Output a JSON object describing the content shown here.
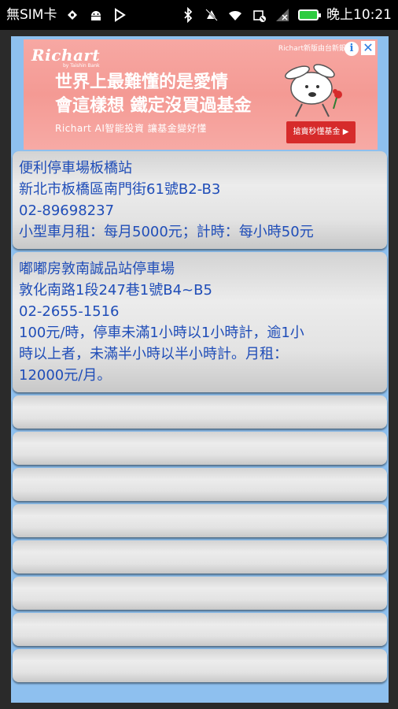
{
  "status_bar": {
    "carrier": "無SIM卡",
    "time": "晚上10:21"
  },
  "ad": {
    "brand": "Richart",
    "brand_sub": "by Taishin Bank",
    "headline_line1": "世界上最難懂的是愛情",
    "headline_line2": "會這樣想 鐵定沒買過基金",
    "tagline": "Richart AI智能投資 讓基金變好懂",
    "corner_text": "Richart新版由台新銀",
    "cta_label": "搶賣秒懂基金 ▶",
    "info_symbol": "i",
    "close_symbol": "✕"
  },
  "parking_list": [
    {
      "name": "便利停車場板橋站",
      "address": "新北市板橋區南門街61號B2-B3",
      "phone": "02-89698237",
      "details": "小型車月租：每月5000元；計時：每小時50元"
    },
    {
      "name": "嘟嘟房敦南誠品站停車場",
      "address": "敦化南路1段247巷1號B4~B5",
      "phone": "02-2655-1516",
      "details_lines": [
        "100元/時，停車未滿1小時以1小時計，逾1小",
        "時以上者，未滿半小時以半小時計。月租：",
        "12000元/月。"
      ]
    }
  ],
  "empty_rows": 8,
  "colors": {
    "background": "#8ec0ef",
    "item_text": "#1f4db8",
    "ad_background": "#f49a94",
    "ad_cta": "#d62b2b"
  }
}
